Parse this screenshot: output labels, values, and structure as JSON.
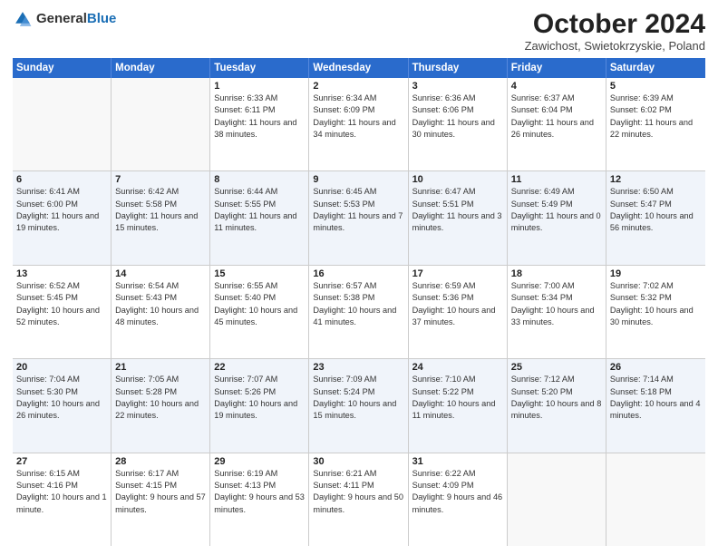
{
  "header": {
    "logo_general": "General",
    "logo_blue": "Blue",
    "title": "October 2024",
    "subtitle": "Zawichost, Swietokrzyskie, Poland"
  },
  "days_of_week": [
    "Sunday",
    "Monday",
    "Tuesday",
    "Wednesday",
    "Thursday",
    "Friday",
    "Saturday"
  ],
  "weeks": [
    [
      {
        "day": "",
        "sunrise": "",
        "sunset": "",
        "daylight": ""
      },
      {
        "day": "",
        "sunrise": "",
        "sunset": "",
        "daylight": ""
      },
      {
        "day": "1",
        "sunrise": "Sunrise: 6:33 AM",
        "sunset": "Sunset: 6:11 PM",
        "daylight": "Daylight: 11 hours and 38 minutes."
      },
      {
        "day": "2",
        "sunrise": "Sunrise: 6:34 AM",
        "sunset": "Sunset: 6:09 PM",
        "daylight": "Daylight: 11 hours and 34 minutes."
      },
      {
        "day": "3",
        "sunrise": "Sunrise: 6:36 AM",
        "sunset": "Sunset: 6:06 PM",
        "daylight": "Daylight: 11 hours and 30 minutes."
      },
      {
        "day": "4",
        "sunrise": "Sunrise: 6:37 AM",
        "sunset": "Sunset: 6:04 PM",
        "daylight": "Daylight: 11 hours and 26 minutes."
      },
      {
        "day": "5",
        "sunrise": "Sunrise: 6:39 AM",
        "sunset": "Sunset: 6:02 PM",
        "daylight": "Daylight: 11 hours and 22 minutes."
      }
    ],
    [
      {
        "day": "6",
        "sunrise": "Sunrise: 6:41 AM",
        "sunset": "Sunset: 6:00 PM",
        "daylight": "Daylight: 11 hours and 19 minutes."
      },
      {
        "day": "7",
        "sunrise": "Sunrise: 6:42 AM",
        "sunset": "Sunset: 5:58 PM",
        "daylight": "Daylight: 11 hours and 15 minutes."
      },
      {
        "day": "8",
        "sunrise": "Sunrise: 6:44 AM",
        "sunset": "Sunset: 5:55 PM",
        "daylight": "Daylight: 11 hours and 11 minutes."
      },
      {
        "day": "9",
        "sunrise": "Sunrise: 6:45 AM",
        "sunset": "Sunset: 5:53 PM",
        "daylight": "Daylight: 11 hours and 7 minutes."
      },
      {
        "day": "10",
        "sunrise": "Sunrise: 6:47 AM",
        "sunset": "Sunset: 5:51 PM",
        "daylight": "Daylight: 11 hours and 3 minutes."
      },
      {
        "day": "11",
        "sunrise": "Sunrise: 6:49 AM",
        "sunset": "Sunset: 5:49 PM",
        "daylight": "Daylight: 11 hours and 0 minutes."
      },
      {
        "day": "12",
        "sunrise": "Sunrise: 6:50 AM",
        "sunset": "Sunset: 5:47 PM",
        "daylight": "Daylight: 10 hours and 56 minutes."
      }
    ],
    [
      {
        "day": "13",
        "sunrise": "Sunrise: 6:52 AM",
        "sunset": "Sunset: 5:45 PM",
        "daylight": "Daylight: 10 hours and 52 minutes."
      },
      {
        "day": "14",
        "sunrise": "Sunrise: 6:54 AM",
        "sunset": "Sunset: 5:43 PM",
        "daylight": "Daylight: 10 hours and 48 minutes."
      },
      {
        "day": "15",
        "sunrise": "Sunrise: 6:55 AM",
        "sunset": "Sunset: 5:40 PM",
        "daylight": "Daylight: 10 hours and 45 minutes."
      },
      {
        "day": "16",
        "sunrise": "Sunrise: 6:57 AM",
        "sunset": "Sunset: 5:38 PM",
        "daylight": "Daylight: 10 hours and 41 minutes."
      },
      {
        "day": "17",
        "sunrise": "Sunrise: 6:59 AM",
        "sunset": "Sunset: 5:36 PM",
        "daylight": "Daylight: 10 hours and 37 minutes."
      },
      {
        "day": "18",
        "sunrise": "Sunrise: 7:00 AM",
        "sunset": "Sunset: 5:34 PM",
        "daylight": "Daylight: 10 hours and 33 minutes."
      },
      {
        "day": "19",
        "sunrise": "Sunrise: 7:02 AM",
        "sunset": "Sunset: 5:32 PM",
        "daylight": "Daylight: 10 hours and 30 minutes."
      }
    ],
    [
      {
        "day": "20",
        "sunrise": "Sunrise: 7:04 AM",
        "sunset": "Sunset: 5:30 PM",
        "daylight": "Daylight: 10 hours and 26 minutes."
      },
      {
        "day": "21",
        "sunrise": "Sunrise: 7:05 AM",
        "sunset": "Sunset: 5:28 PM",
        "daylight": "Daylight: 10 hours and 22 minutes."
      },
      {
        "day": "22",
        "sunrise": "Sunrise: 7:07 AM",
        "sunset": "Sunset: 5:26 PM",
        "daylight": "Daylight: 10 hours and 19 minutes."
      },
      {
        "day": "23",
        "sunrise": "Sunrise: 7:09 AM",
        "sunset": "Sunset: 5:24 PM",
        "daylight": "Daylight: 10 hours and 15 minutes."
      },
      {
        "day": "24",
        "sunrise": "Sunrise: 7:10 AM",
        "sunset": "Sunset: 5:22 PM",
        "daylight": "Daylight: 10 hours and 11 minutes."
      },
      {
        "day": "25",
        "sunrise": "Sunrise: 7:12 AM",
        "sunset": "Sunset: 5:20 PM",
        "daylight": "Daylight: 10 hours and 8 minutes."
      },
      {
        "day": "26",
        "sunrise": "Sunrise: 7:14 AM",
        "sunset": "Sunset: 5:18 PM",
        "daylight": "Daylight: 10 hours and 4 minutes."
      }
    ],
    [
      {
        "day": "27",
        "sunrise": "Sunrise: 6:15 AM",
        "sunset": "Sunset: 4:16 PM",
        "daylight": "Daylight: 10 hours and 1 minute."
      },
      {
        "day": "28",
        "sunrise": "Sunrise: 6:17 AM",
        "sunset": "Sunset: 4:15 PM",
        "daylight": "Daylight: 9 hours and 57 minutes."
      },
      {
        "day": "29",
        "sunrise": "Sunrise: 6:19 AM",
        "sunset": "Sunset: 4:13 PM",
        "daylight": "Daylight: 9 hours and 53 minutes."
      },
      {
        "day": "30",
        "sunrise": "Sunrise: 6:21 AM",
        "sunset": "Sunset: 4:11 PM",
        "daylight": "Daylight: 9 hours and 50 minutes."
      },
      {
        "day": "31",
        "sunrise": "Sunrise: 6:22 AM",
        "sunset": "Sunset: 4:09 PM",
        "daylight": "Daylight: 9 hours and 46 minutes."
      },
      {
        "day": "",
        "sunrise": "",
        "sunset": "",
        "daylight": ""
      },
      {
        "day": "",
        "sunrise": "",
        "sunset": "",
        "daylight": ""
      }
    ]
  ]
}
